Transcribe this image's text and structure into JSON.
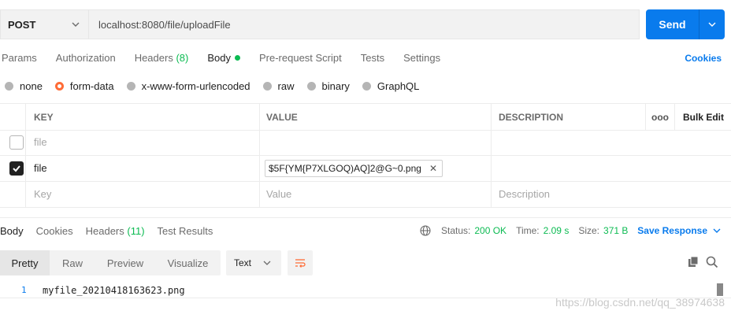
{
  "request": {
    "method": "POST",
    "url": "localhost:8080/file/uploadFile",
    "send_label": "Send"
  },
  "tabs": [
    {
      "label": "Params"
    },
    {
      "label": "Authorization"
    },
    {
      "label": "Headers",
      "count": "(8)"
    },
    {
      "label": "Body"
    },
    {
      "label": "Pre-request Script"
    },
    {
      "label": "Tests"
    },
    {
      "label": "Settings"
    }
  ],
  "cookies_label": "Cookies",
  "body_types": [
    "none",
    "form-data",
    "x-www-form-urlencoded",
    "raw",
    "binary",
    "GraphQL"
  ],
  "table": {
    "headers": {
      "key": "KEY",
      "value": "VALUE",
      "description": "DESCRIPTION",
      "bulk_edit": "Bulk Edit",
      "more": "ooo"
    },
    "rows": [
      {
        "key": "file",
        "value": "",
        "description": "",
        "checked": false
      },
      {
        "key": "file",
        "value": "$5F{YM{P7XLGOQ)AQ]2@G~0.png",
        "description": "",
        "checked": true
      },
      {
        "key": "Key",
        "value": "Value",
        "description": "Description"
      }
    ]
  },
  "response": {
    "tabs": [
      {
        "label": "Body"
      },
      {
        "label": "Cookies"
      },
      {
        "label": "Headers",
        "count": "(11)"
      },
      {
        "label": "Test Results"
      }
    ],
    "status_label": "Status:",
    "status_value": "200 OK",
    "time_label": "Time:",
    "time_value": "2.09 s",
    "size_label": "Size:",
    "size_value": "371 B",
    "save_label": "Save Response",
    "views": [
      "Pretty",
      "Raw",
      "Preview",
      "Visualize"
    ],
    "format": "Text",
    "line_number": "1",
    "body_text": "myfile_20210418163623.png"
  },
  "watermark": "https://blog.csdn.net/qq_38974638",
  "colors": {
    "accent": "#097bed",
    "success": "#0cbb52",
    "brand": "#ff6c37"
  }
}
